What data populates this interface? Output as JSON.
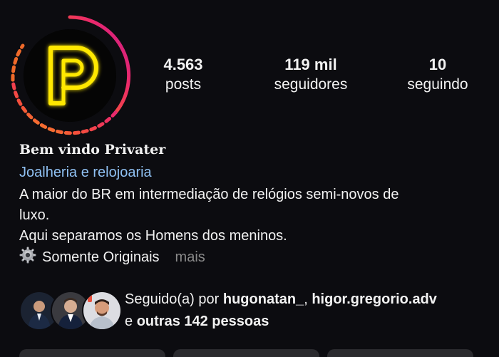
{
  "profile": {
    "stats": {
      "posts_count": "4.563",
      "posts_label": "posts",
      "followers_count": "119 mil",
      "followers_label": "seguidores",
      "following_count": "10",
      "following_label": "seguindo"
    },
    "name": "Bem vindo Privater",
    "category": "Joalheria e relojoaria",
    "bio_lines": [
      "A maior do BR em intermediação de relógios semi-novos de",
      "luxo.",
      "Aqui separamos os Homens dos meninos."
    ],
    "bio_last_line": "Somente Originais",
    "more_label": "mais",
    "followed_by": {
      "prefix": "Seguido(a) por",
      "user1": "hugonatan_",
      "separator": ",",
      "user2": "higor.gregorio.adv",
      "and": "e",
      "others": "outras 142 pessoas"
    }
  },
  "colors": {
    "background": "#0c0c10",
    "category_link": "#8fc0f2",
    "neon_yellow": "#ffe800",
    "story_ring_start": "#e1306c",
    "story_ring_end": "#f7a21b"
  },
  "icons": {
    "avatar_logo": "neon-p-logo-icon",
    "bio_gear": "gear-icon"
  }
}
